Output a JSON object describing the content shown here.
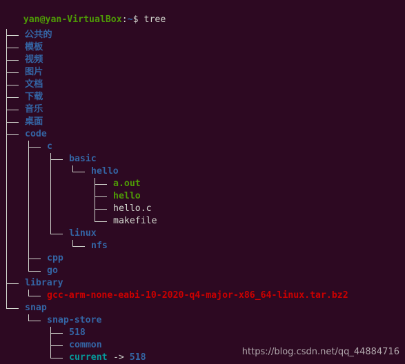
{
  "terminal": {
    "background_color": "#2d0922",
    "foreground_color": "#d3d7cf",
    "columns": 72,
    "rows": 29,
    "char_width": 8,
    "line_height": 18
  },
  "colors": {
    "user_host": "#4e9a06",
    "path": "#3465a4",
    "directory": "#3465a4",
    "executable": "#4e9a06",
    "regular_file": "#d3d7cf",
    "archive": "#cc0000",
    "symlink": "#06989a",
    "tree_lines": "#d3d7cf",
    "watermark": "#b8b0b4"
  },
  "prompt": {
    "user_host": "yan@yan-VirtualBox",
    "separator": ":",
    "path": "~",
    "sigil": "$",
    "command": "tree"
  },
  "tree": {
    "root": ".",
    "nodes": [
      {
        "label": "公共的",
        "depth": 0,
        "kind": "directory",
        "last": false,
        "cjk": true
      },
      {
        "label": "模板",
        "depth": 0,
        "kind": "directory",
        "last": false,
        "cjk": true
      },
      {
        "label": "视频",
        "depth": 0,
        "kind": "directory",
        "last": false,
        "cjk": true
      },
      {
        "label": "图片",
        "depth": 0,
        "kind": "directory",
        "last": false,
        "cjk": true
      },
      {
        "label": "文档",
        "depth": 0,
        "kind": "directory",
        "last": false,
        "cjk": true
      },
      {
        "label": "下载",
        "depth": 0,
        "kind": "directory",
        "last": false,
        "cjk": true
      },
      {
        "label": "音乐",
        "depth": 0,
        "kind": "directory",
        "last": false,
        "cjk": true
      },
      {
        "label": "桌面",
        "depth": 0,
        "kind": "directory",
        "last": false,
        "cjk": true
      },
      {
        "label": "code",
        "depth": 0,
        "kind": "directory",
        "last": false,
        "cjk": false
      },
      {
        "label": "c",
        "depth": 1,
        "kind": "directory",
        "last": false,
        "cjk": false
      },
      {
        "label": "basic",
        "depth": 2,
        "kind": "directory",
        "last": false,
        "cjk": false
      },
      {
        "label": "hello",
        "depth": 3,
        "kind": "directory",
        "last": true,
        "cjk": false
      },
      {
        "label": "a.out",
        "depth": 4,
        "kind": "executable",
        "last": false,
        "cjk": false
      },
      {
        "label": "hello",
        "depth": 4,
        "kind": "executable",
        "last": false,
        "cjk": false
      },
      {
        "label": "hello.c",
        "depth": 4,
        "kind": "file",
        "last": false,
        "cjk": false
      },
      {
        "label": "makefile",
        "depth": 4,
        "kind": "file",
        "last": true,
        "cjk": false
      },
      {
        "label": "linux",
        "depth": 2,
        "kind": "directory",
        "last": true,
        "cjk": false
      },
      {
        "label": "nfs",
        "depth": 3,
        "kind": "directory",
        "last": true,
        "cjk": false
      },
      {
        "label": "cpp",
        "depth": 1,
        "kind": "directory",
        "last": false,
        "cjk": false
      },
      {
        "label": "go",
        "depth": 1,
        "kind": "directory",
        "last": true,
        "cjk": false
      },
      {
        "label": "library",
        "depth": 0,
        "kind": "directory",
        "last": false,
        "cjk": false
      },
      {
        "label": "gcc-arm-none-eabi-10-2020-q4-major-x86_64-linux.tar.bz2",
        "depth": 1,
        "kind": "archive",
        "last": true,
        "cjk": false
      },
      {
        "label": "snap",
        "depth": 0,
        "kind": "directory",
        "last": true,
        "cjk": false
      },
      {
        "label": "snap-store",
        "depth": 1,
        "kind": "directory",
        "last": true,
        "cjk": false
      },
      {
        "label": "518",
        "depth": 2,
        "kind": "directory",
        "last": false,
        "cjk": false
      },
      {
        "label": "common",
        "depth": 2,
        "kind": "directory",
        "last": false,
        "cjk": false
      },
      {
        "label": "current",
        "depth": 2,
        "kind": "symlink",
        "last": true,
        "cjk": false,
        "link_arrow": " -> ",
        "link_target": "518"
      }
    ]
  },
  "watermark": {
    "text": "https://blog.csdn.net/qq_44884716"
  }
}
